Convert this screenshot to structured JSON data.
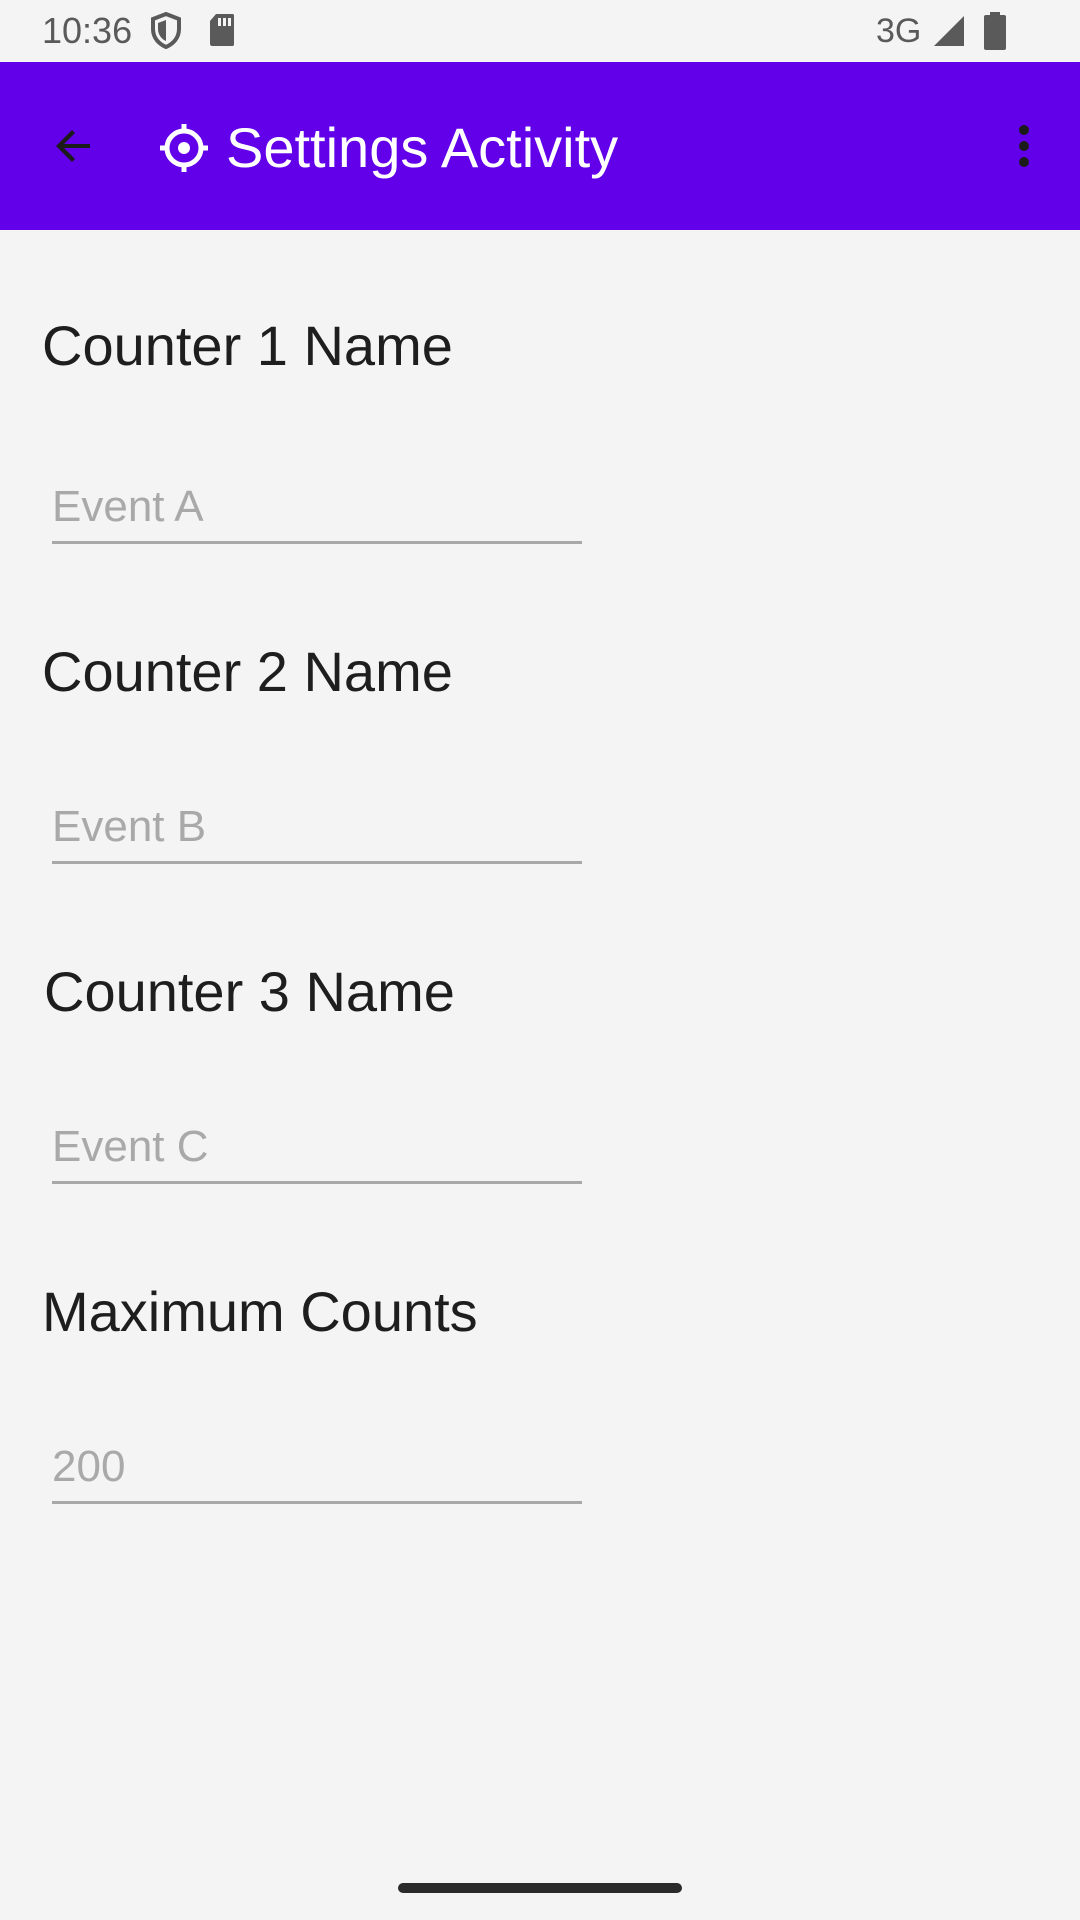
{
  "status_bar": {
    "time": "10:36",
    "network": "3G",
    "icons": [
      "shield-icon",
      "sd-card-icon",
      "signal-icon",
      "battery-icon"
    ]
  },
  "app_bar": {
    "title": "Settings Activity",
    "background_color": "#6200ea",
    "icons": [
      "back-arrow-icon",
      "settings-gear-icon",
      "more-vert-icon"
    ]
  },
  "settings": {
    "counter1": {
      "label": "Counter 1 Name",
      "value": "",
      "placeholder": "Event A"
    },
    "counter2": {
      "label": "Counter 2 Name",
      "value": "",
      "placeholder": "Event B"
    },
    "counter3": {
      "label": "Counter 3 Name",
      "value": "",
      "placeholder": "Event C"
    },
    "max_counts": {
      "label": "Maximum Counts",
      "value": "",
      "placeholder": "200"
    }
  }
}
